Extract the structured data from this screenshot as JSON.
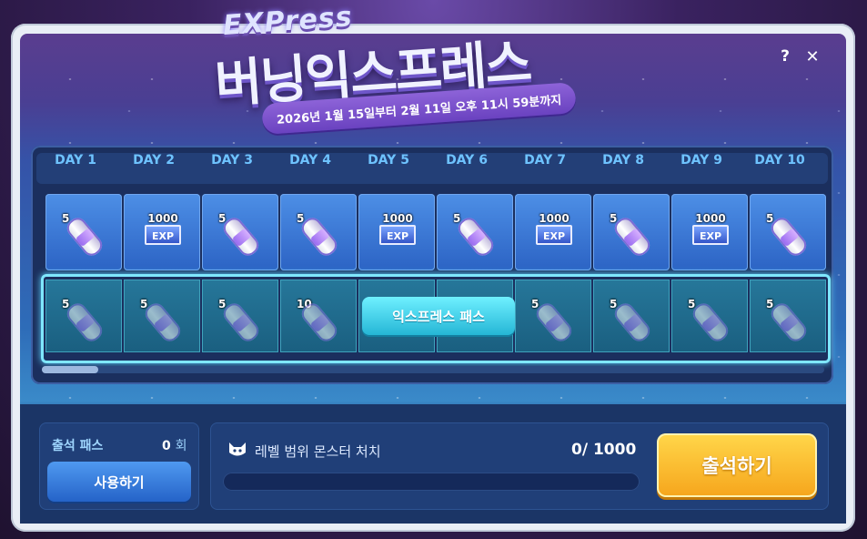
{
  "event": {
    "logo_sub": "EXPress",
    "logo_main": "버닝익스프레스",
    "date_range": "2026년 1월 15일부터 2월 11일 오후 11시 59분까지"
  },
  "controls": {
    "help_label": "?",
    "close_label": "✕"
  },
  "days": [
    "DAY 1",
    "DAY 2",
    "DAY 3",
    "DAY 4",
    "DAY 5",
    "DAY 6",
    "DAY 7",
    "DAY 8",
    "DAY 9",
    "DAY 10"
  ],
  "free_rewards": [
    {
      "type": "capsule",
      "amount": "5"
    },
    {
      "type": "exp",
      "amount": "1000",
      "label": "EXP"
    },
    {
      "type": "capsule",
      "amount": "5"
    },
    {
      "type": "capsule",
      "amount": "5"
    },
    {
      "type": "exp",
      "amount": "1000",
      "label": "EXP"
    },
    {
      "type": "capsule",
      "amount": "5"
    },
    {
      "type": "exp",
      "amount": "1000",
      "label": "EXP"
    },
    {
      "type": "capsule",
      "amount": "5"
    },
    {
      "type": "exp",
      "amount": "1000",
      "label": "EXP"
    },
    {
      "type": "capsule",
      "amount": "5"
    }
  ],
  "pass_rewards": [
    {
      "type": "capsule",
      "amount": "5"
    },
    {
      "type": "capsule",
      "amount": "5"
    },
    {
      "type": "capsule",
      "amount": "5"
    },
    {
      "type": "capsule",
      "amount": "10"
    },
    {
      "type": "hidden",
      "amount": ""
    },
    {
      "type": "hidden",
      "amount": ""
    },
    {
      "type": "capsule",
      "amount": "5"
    },
    {
      "type": "capsule",
      "amount": "5"
    },
    {
      "type": "capsule",
      "amount": "5"
    },
    {
      "type": "capsule",
      "amount": "5"
    }
  ],
  "pass_button_label": "익스프레스 패스",
  "attendance_pass": {
    "label": "출석 패스",
    "count": "0",
    "unit": "회",
    "use_button": "사용하기"
  },
  "mission": {
    "icon": "cat-face-icon",
    "text": "레벨 범위 몬스터 처치",
    "current": "0",
    "total": "1000",
    "progress_text": "0/ 1000",
    "progress_fraction": 0
  },
  "attend_button": "출석하기",
  "colors": {
    "accent_yellow": "#f6a51c",
    "day_label": "#6ec3ff",
    "pass_highlight": "#7fe7ff"
  }
}
